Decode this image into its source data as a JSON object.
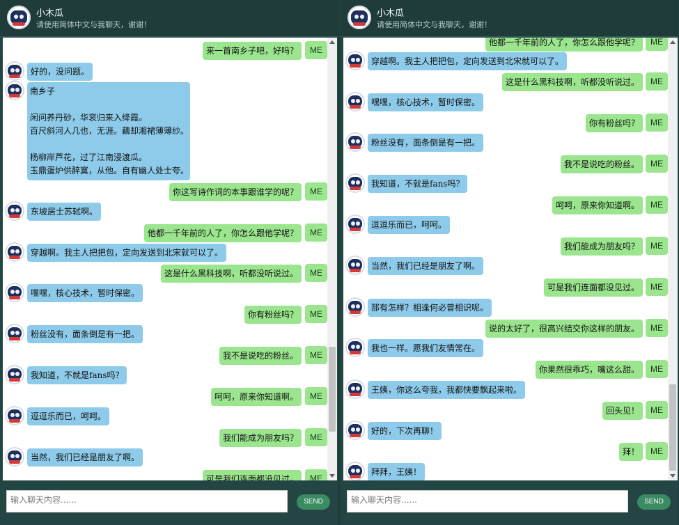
{
  "left": {
    "header": {
      "title": "小木瓜",
      "subtitle": "请使用简体中文与我聊天，谢谢！"
    },
    "messages": [
      {
        "who": "me",
        "text": "来一首南乡子吧，好吗？"
      },
      {
        "who": "bot",
        "text": "好的，没问题。"
      },
      {
        "who": "bot",
        "text": "南乡子\n\n闲问养丹砂，华衮归来入绛霞。\n百尺斜河人几也，无涯。藕却湘裙薄薄纱。\n\n杨柳岸芦花，过了江南浸渡瓜。\n玉鼎蛋炉供醉寞，从他。自有幽人处士夸。"
      },
      {
        "who": "me",
        "text": "你这写诗作词的本事跟谁学的呢？"
      },
      {
        "who": "bot",
        "text": "东坡居士苏轼啊。"
      },
      {
        "who": "me",
        "text": "他都一千年前的人了，你怎么跟他学呢？"
      },
      {
        "who": "bot",
        "text": "穿越啊。我主人把把包，定向发送到北宋就可以了。"
      },
      {
        "who": "me",
        "text": "这是什么黑科技啊，听都没听说过。"
      },
      {
        "who": "bot",
        "text": "嘿嘿，核心技术，暂时保密。"
      },
      {
        "who": "me",
        "text": "你有粉丝吗？"
      },
      {
        "who": "bot",
        "text": "粉丝没有，面条倒是有一把。"
      },
      {
        "who": "me",
        "text": "我不是说吃的粉丝。"
      },
      {
        "who": "bot",
        "text": "我知道，不就是fans吗？"
      },
      {
        "who": "me",
        "text": "呵呵，原来你知道啊。"
      },
      {
        "who": "bot",
        "text": "逗逗乐而已，呵呵。"
      },
      {
        "who": "me",
        "text": "我们能成为朋友吗？"
      },
      {
        "who": "bot",
        "text": "当然，我们已经是朋友了啊。"
      },
      {
        "who": "me",
        "text": "可是我们连面都没见过。"
      }
    ],
    "input_placeholder": "输入聊天内容......",
    "send_label": "SEND"
  },
  "right": {
    "header": {
      "title": "小木瓜",
      "subtitle": "请使用简体中文与我聊天，谢谢！"
    },
    "messages": [
      {
        "who": "me",
        "text": "他都一千年前的人了，你怎么跟他学呢？"
      },
      {
        "who": "bot",
        "text": "穿越啊。我主人把把包，定向发送到北宋就可以了。"
      },
      {
        "who": "me",
        "text": "这是什么黑科技啊，听都没听说过。"
      },
      {
        "who": "bot",
        "text": "嘿嘿，核心技术，暂时保密。"
      },
      {
        "who": "me",
        "text": "你有粉丝吗？"
      },
      {
        "who": "bot",
        "text": "粉丝没有，面条倒是有一把。"
      },
      {
        "who": "me",
        "text": "我不是说吃的粉丝。"
      },
      {
        "who": "bot",
        "text": "我知道，不就是fans吗？"
      },
      {
        "who": "me",
        "text": "呵呵，原来你知道啊。"
      },
      {
        "who": "bot",
        "text": "逗逗乐而已，呵呵。"
      },
      {
        "who": "me",
        "text": "我们能成为朋友吗？"
      },
      {
        "who": "bot",
        "text": "当然，我们已经是朋友了啊。"
      },
      {
        "who": "me",
        "text": "可是我们连面都没见过。"
      },
      {
        "who": "bot",
        "text": "那有怎样？相逢何必曾相识呢。"
      },
      {
        "who": "me",
        "text": "说的太好了，很高兴结交你这样的朋友。"
      },
      {
        "who": "bot",
        "text": "我也一样。愿我们友情常在。"
      },
      {
        "who": "me",
        "text": "你果然很乖巧，嘴这么甜。"
      },
      {
        "who": "bot",
        "text": "王姨，你这么夸我，我都快要飘起来啦。"
      },
      {
        "who": "me",
        "text": "回头见！"
      },
      {
        "who": "bot",
        "text": "好的，下次再聊！"
      },
      {
        "who": "me",
        "text": "拜！"
      },
      {
        "who": "bot",
        "text": "拜拜，王姨！"
      }
    ],
    "input_placeholder": "输入聊天内容......",
    "send_label": "SEND"
  },
  "me_tag": "ME",
  "colors": {
    "bot_bubble": "#8ecbea",
    "me_bubble": "#9be58f",
    "header_bg": "#1f3c3b",
    "send_button": "#3a8a62"
  }
}
